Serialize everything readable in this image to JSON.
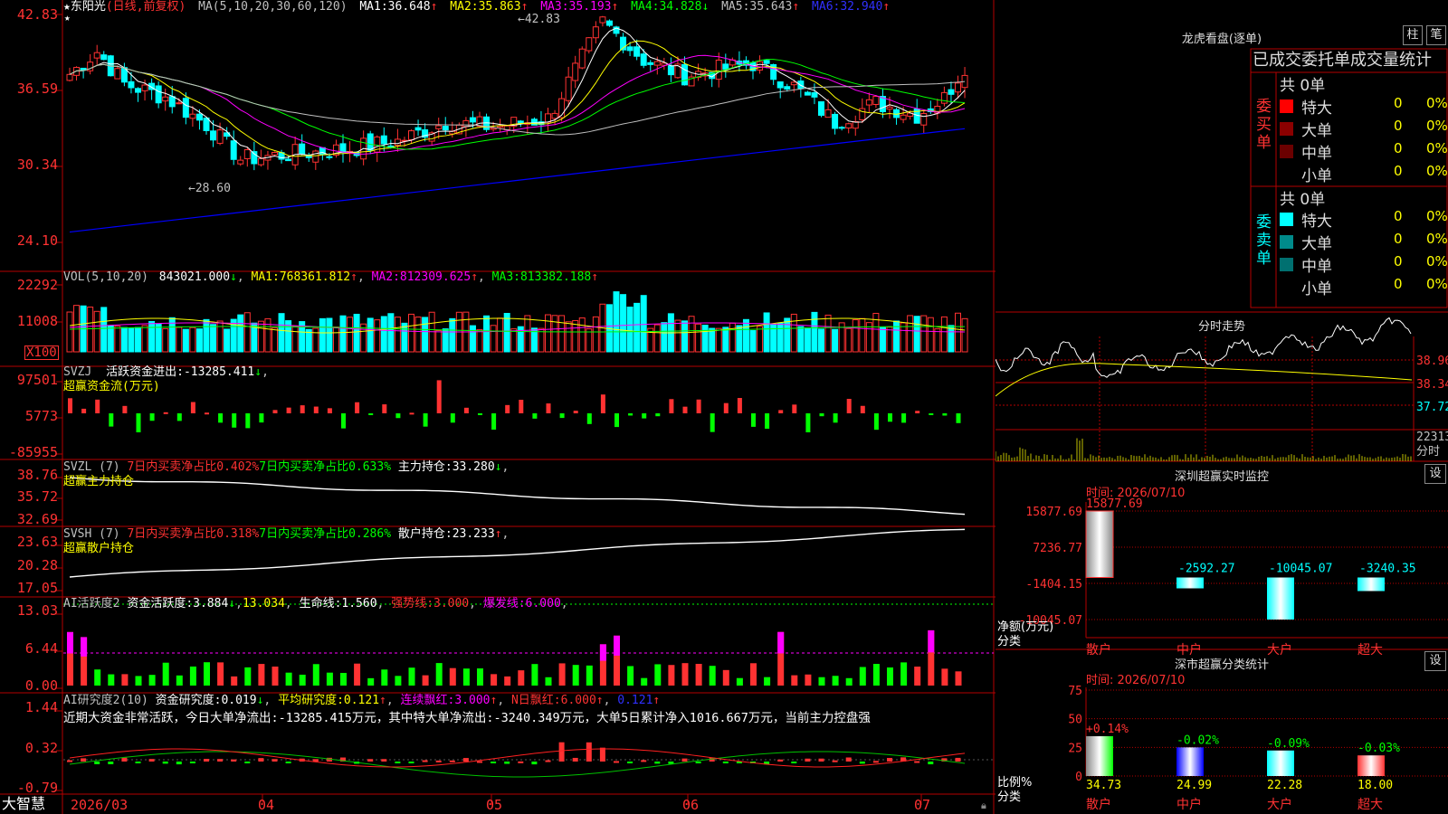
{
  "colors": {
    "up": "#ff3232",
    "down": "#00ffff",
    "grid": "#b40000",
    "ma1": "#ffffff",
    "ma2": "#ffff00",
    "ma3": "#ff00ff",
    "ma4": "#00ff00",
    "ma5": "#c0c0c0",
    "ma6": "#0000ff"
  },
  "main": {
    "stock": "东阳光",
    "period": "(日线,前复权)",
    "ma_label": "MA(5,10,20,30,60,120)",
    "ma": [
      {
        "label": "MA1:",
        "value": "36.648",
        "arrow": "↑"
      },
      {
        "label": "MA2:",
        "value": "35.863",
        "arrow": "↑"
      },
      {
        "label": "MA3:",
        "value": "35.193",
        "arrow": "↑"
      },
      {
        "label": "MA4:",
        "value": "34.828",
        "arrow": "↓"
      },
      {
        "label": "MA5:",
        "value": "35.643",
        "arrow": "↑"
      },
      {
        "label": "MA6:",
        "value": "32.940",
        "arrow": "↑"
      }
    ],
    "y_labels": [
      "42.83",
      "36.59",
      "30.34",
      "24.10"
    ],
    "high_label": "42.83",
    "low_label": "28.60"
  },
  "vol": {
    "name": "VOL(5,10,20)",
    "value": "843021.000",
    "arrow": "↓",
    "ma": [
      {
        "label": "MA1:",
        "value": "768361.812",
        "arrow": "↑"
      },
      {
        "label": "MA2:",
        "value": "812309.625",
        "arrow": "↑"
      },
      {
        "label": "MA3:",
        "value": "813382.188",
        "arrow": "↑"
      }
    ],
    "y_labels": [
      "22292",
      "11008"
    ],
    "unit": "X100"
  },
  "svzj": {
    "name": "SVZJ",
    "label": "活跃资金进出:",
    "value": "-13285.411",
    "arrow": "↓",
    "sub": "超赢资金流(万元)",
    "y_labels": [
      "97501",
      "5773",
      "-85955"
    ]
  },
  "svzl": {
    "name": "SVZL (7)",
    "a": "7日内买卖净占比0.402%",
    "b": "7日内买卖净占比0.633%",
    "c": "主力持仓:",
    "value": "33.280",
    "arrow": "↓",
    "sub": "超赢主力持仓",
    "y_labels": [
      "38.76",
      "35.72",
      "32.69"
    ]
  },
  "svsh": {
    "name": "SVSH (7)",
    "a": "7日内买卖净占比0.318%",
    "b": "7日内买卖净占比0.286%",
    "c": "散户持仓:",
    "value": "23.233",
    "arrow": "↑",
    "sub": "超赢散户持仓",
    "y_labels": [
      "23.63",
      "20.28",
      "17.05"
    ]
  },
  "ai1": {
    "name": "AI活跃度2",
    "a": "资金活跃度:",
    "a_val": "3.884",
    "a_arrow": "↓",
    "b_val": "13.034",
    "c": "生命线:",
    "c_val": "1.560",
    "d": "强势线:",
    "d_val": "3.000",
    "e": "爆发线:",
    "e_val": "6.000",
    "y_labels": [
      "13.03",
      "6.44",
      "0.00"
    ]
  },
  "ai2": {
    "name": "AI研究度2(10)",
    "a": "资金研究度:",
    "a_val": "0.019",
    "a_arrow": "↓",
    "b": "平均研究度:",
    "b_val": "0.121",
    "b_arrow": "↑",
    "c": "连续飘红:",
    "c_val": "3.000",
    "c_arrow": "↑",
    "d": "N日飘红:",
    "d_val": "6.000",
    "d_arrow": "↑",
    "e_val": "0.121",
    "e_arrow": "↑",
    "text": "近期大资金非常活跃，今日大单净流出:-13285.415万元，其中特大单净流出:-3240.349万元，大单5日累计净入1016.667万元，当前主力控盘强",
    "y_labels": [
      "1.44",
      "0.32",
      "-0.79"
    ]
  },
  "xaxis": {
    "brand": "大智慧",
    "labels": [
      "2026/03",
      "04",
      "05",
      "06",
      "07"
    ]
  },
  "dragon": {
    "title": "龙虎看盘(逐单)",
    "btn1": "柱",
    "btn2": "笔",
    "header": "已成交委托单成交量统计",
    "buy_label": "委买单",
    "sell_label": "委卖单",
    "buy_total": "共 0单",
    "sell_total": "共 0单",
    "buy_rows": [
      {
        "name": "特大",
        "count": "0",
        "pct": "0%",
        "color": "#ff0000"
      },
      {
        "name": "大单",
        "count": "0",
        "pct": "0%",
        "color": "#8b0000"
      },
      {
        "name": "中单",
        "count": "0",
        "pct": "0%",
        "color": "#6b0000"
      },
      {
        "name": "小单",
        "count": "0",
        "pct": "0%",
        "color": ""
      }
    ],
    "sell_rows": [
      {
        "name": "特大",
        "count": "0",
        "pct": "0%",
        "color": "#00ffff"
      },
      {
        "name": "大单",
        "count": "0",
        "pct": "0%",
        "color": "#008b8b"
      },
      {
        "name": "中单",
        "count": "0",
        "pct": "0%",
        "color": "#007070"
      },
      {
        "name": "小单",
        "count": "0",
        "pct": "0%",
        "color": ""
      }
    ]
  },
  "intraday": {
    "title": "分时走势",
    "y_labels": [
      "38.96",
      "38.34",
      "37.72",
      "22313"
    ],
    "unit": "分时"
  },
  "monitor": {
    "title": "深圳超赢实时监控",
    "btn": "设",
    "time": "时间: 2026/07/10",
    "y_labels": [
      "15877.69",
      "7236.77",
      "-1404.15",
      "-10045.07"
    ],
    "axis_label": "净额(万元)",
    "cat_label": "分类",
    "cats": [
      {
        "name": "散户",
        "value": 15877.69,
        "label": "15877.69"
      },
      {
        "name": "中户",
        "value": -2592.27,
        "label": "-2592.27"
      },
      {
        "name": "大户",
        "value": -10045.07,
        "label": "-10045.07"
      },
      {
        "name": "超大",
        "value": -3240.35,
        "label": "-3240.35"
      }
    ]
  },
  "classify": {
    "title": "深市超赢分类统计",
    "btn": "设",
    "time": "时间: 2026/07/10",
    "y_labels": [
      "75",
      "50",
      "25",
      "0"
    ],
    "axis_label": "比例%",
    "cat_label": "分类",
    "cats": [
      {
        "name": "散户",
        "value": 34.73,
        "label": "34.73",
        "delta": "+0.14%"
      },
      {
        "name": "中户",
        "value": 24.99,
        "label": "24.99",
        "delta": "-0.02%"
      },
      {
        "name": "大户",
        "value": 22.28,
        "label": "22.28",
        "delta": "-0.09%"
      },
      {
        "name": "超大",
        "value": 18.0,
        "label": "18.00",
        "delta": "-0.03%"
      }
    ]
  }
}
